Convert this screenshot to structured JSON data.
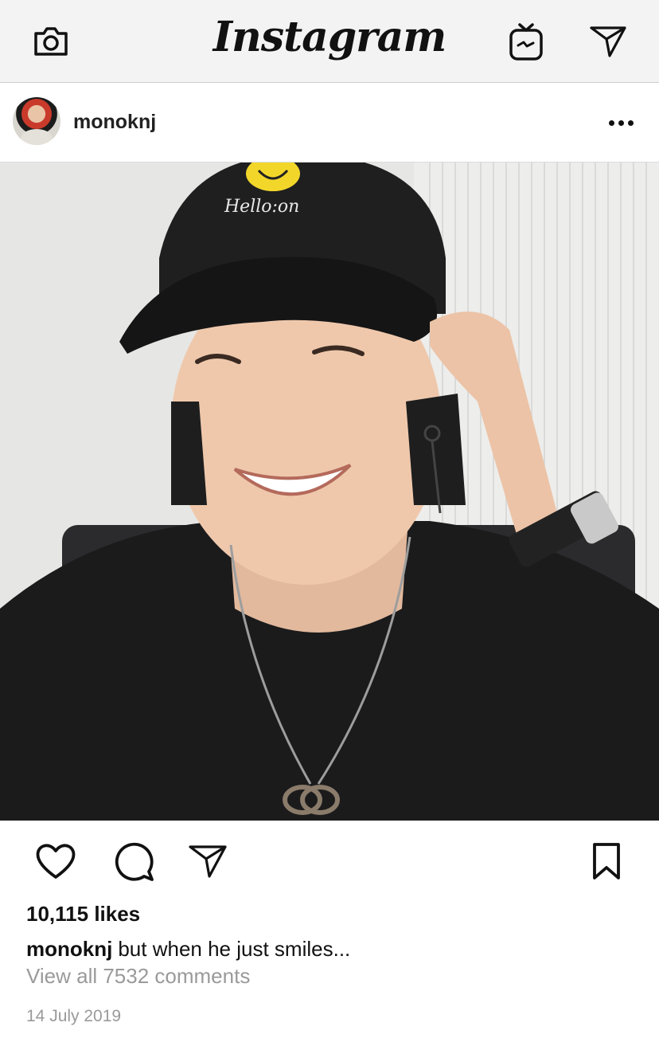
{
  "app": {
    "logo_text": "Instagram",
    "icons": {
      "camera": "camera-icon",
      "igtv": "igtv-icon",
      "direct": "paper-plane-icon"
    }
  },
  "post": {
    "username": "monoknj",
    "avatar": "profile-avatar",
    "more": "more-options-icon",
    "photo": "photo of a smiling man in a black cap reading Hello:on with a smiley face",
    "actions": {
      "like": "heart-icon",
      "comment": "comment-bubble-icon",
      "share": "paper-plane-icon",
      "save": "bookmark-icon"
    },
    "likes_text": "10,115 likes",
    "caption_user": "monoknj",
    "caption_text": "but when he just smiles...",
    "view_comments_text": "View all 7532 comments",
    "date_text": "14 July 2019",
    "cap_text": "Hello:on"
  },
  "colors": {
    "topbar_bg": "#f3f3f3",
    "text_primary": "#111111",
    "text_secondary": "#9a9a9a"
  }
}
